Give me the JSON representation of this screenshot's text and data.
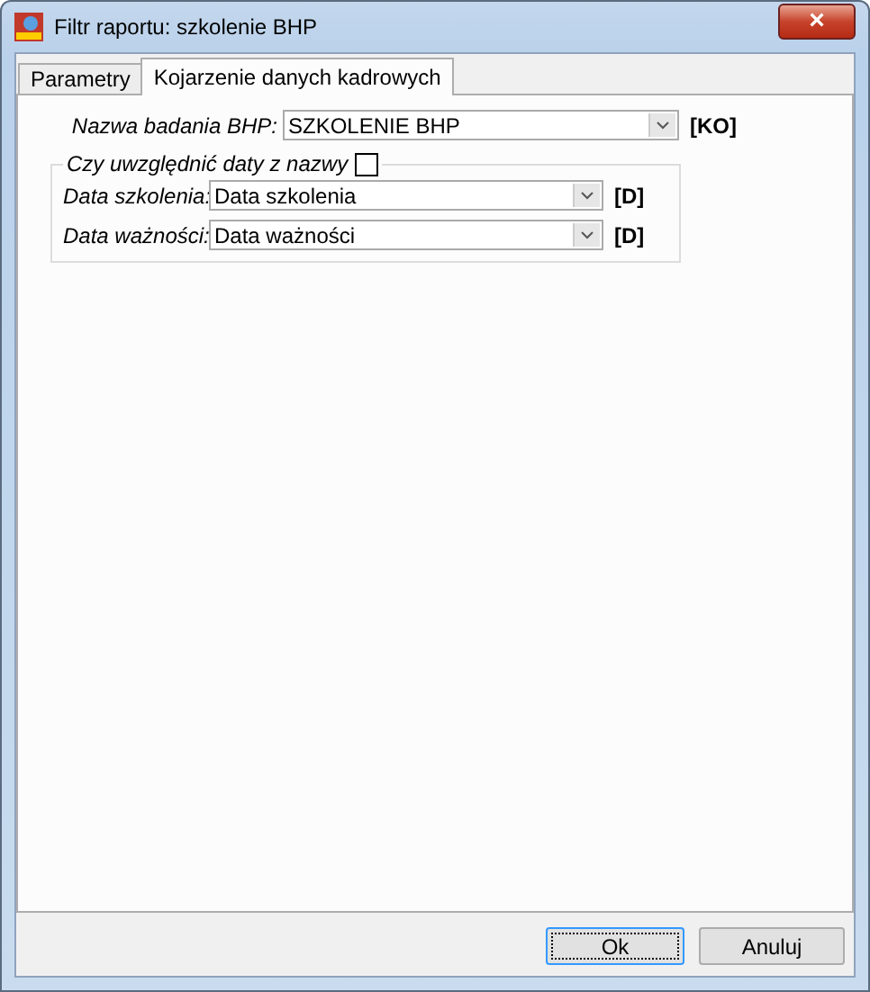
{
  "window": {
    "title": "Filtr raportu: szkolenie BHP",
    "close": "×"
  },
  "tabs": [
    {
      "label": "Parametry",
      "selected": false
    },
    {
      "label": "Kojarzenie danych kadrowych",
      "selected": true
    }
  ],
  "main_field": {
    "label": "Nazwa badania BHP:",
    "value": "SZKOLENIE BHP",
    "suffix": "[KO]"
  },
  "group": {
    "legend": "Czy uwzględnić daty z nazwy",
    "checked": false,
    "fields": [
      {
        "label": "Data szkolenia:",
        "value": "Data szkolenia",
        "suffix": "[D]"
      },
      {
        "label": "Data ważności:",
        "value": "Data ważności",
        "suffix": "[D]"
      }
    ]
  },
  "buttons": [
    {
      "label": "Ok",
      "focused": true
    },
    {
      "label": "Anuluj",
      "focused": false
    }
  ]
}
